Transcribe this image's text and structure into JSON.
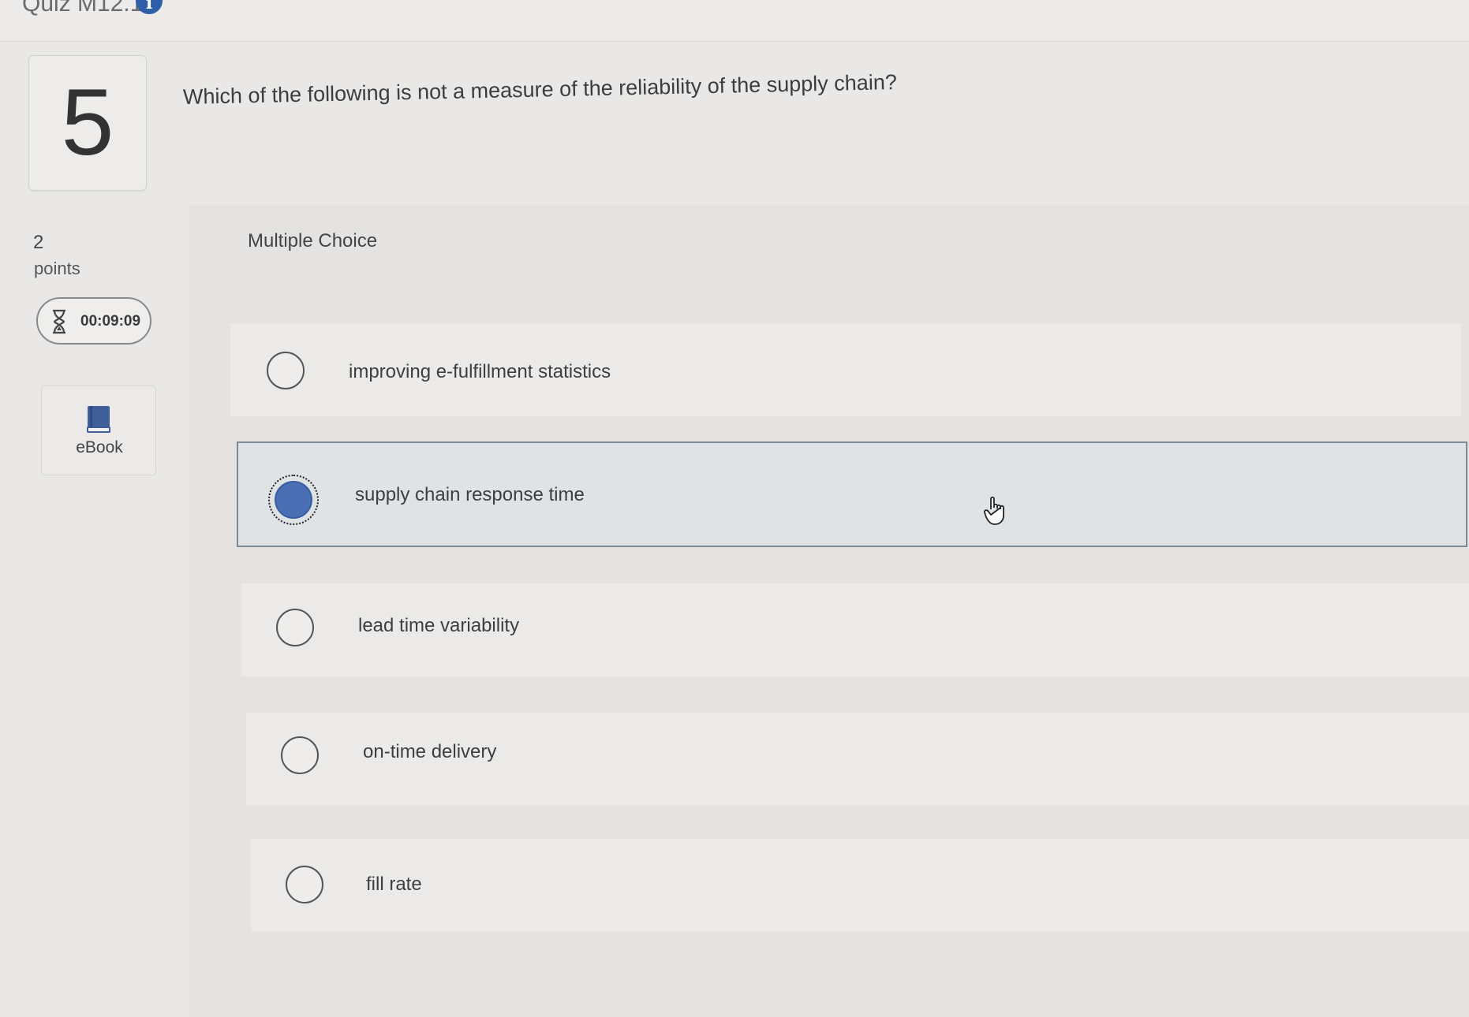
{
  "header": {
    "quiz_title": "Quiz M12.1",
    "info_icon": "info-icon"
  },
  "question": {
    "number": "5",
    "text": "Which of the following is not a measure of the reliability of the supply chain?",
    "points_value": "2",
    "points_label": "points"
  },
  "timer": {
    "icon": "hourglass-icon",
    "value": "00:09:09"
  },
  "ebook": {
    "icon": "book-icon",
    "label": "eBook"
  },
  "answer_type": "Multiple Choice",
  "choices": [
    {
      "label": "improving e-fulfillment statistics",
      "selected": false
    },
    {
      "label": "supply chain response time",
      "selected": true
    },
    {
      "label": "lead time variability",
      "selected": false
    },
    {
      "label": "on-time delivery",
      "selected": false
    },
    {
      "label": "fill rate",
      "selected": false
    }
  ],
  "colors": {
    "selected_radio": "#4a6fb5",
    "info_icon": "#2f5fa8",
    "ebook_icon": "#3e5f9a"
  }
}
